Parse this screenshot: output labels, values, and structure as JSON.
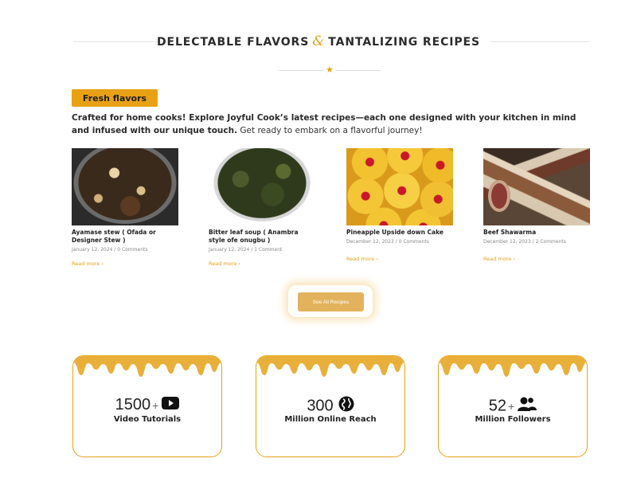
{
  "section": {
    "title_part1": "DELECTABLE FLAVORS",
    "title_amp": "&",
    "title_part2": "TANTALIZING RECIPES",
    "badge": "Fresh flavors",
    "intro_bold": "Crafted for home cooks!  Explore Joyful Cook’s latest recipes—each one designed with your kitchen in mind and infused with our unique touch.",
    "intro_regular": " Get ready to embark on a flavorful journey!"
  },
  "recipes": [
    {
      "title": "Ayamase stew ( Ofada or Designer Stew )",
      "date": "January 12, 2024",
      "comments": "0 Comments",
      "read_more": "Read more",
      "image": "ayamase-stew-photo"
    },
    {
      "title": "Bitter leaf soup ( Anambra style ofe onugbu )",
      "date": "January 12, 2024",
      "comments": "1 Comment",
      "read_more": "Read more",
      "image": "bitter-leaf-soup-photo"
    },
    {
      "title": "Pineapple Upside down Cake",
      "date": "December 12, 2023",
      "comments": "0 Comments",
      "read_more": "Read more",
      "image": "pineapple-cake-photo"
    },
    {
      "title": "Beef Shawarma",
      "date": "December 12, 2023",
      "comments": "2 Comments",
      "read_more": "Read more",
      "image": "beef-shawarma-photo"
    }
  ],
  "cta": {
    "label": "See All Recipes"
  },
  "stats": [
    {
      "number": "1500",
      "plus": "+",
      "label": "Video Tutorials",
      "icon": "youtube-icon"
    },
    {
      "number": "300",
      "plus": "",
      "label": "Million Online Reach",
      "icon": "globe-icon"
    },
    {
      "number": "52",
      "plus": "+",
      "label": "Million Followers",
      "icon": "users-icon"
    }
  ],
  "colors": {
    "accent": "#e8a115",
    "cta": "#e2b35c",
    "text": "#222222"
  },
  "meta_separator": "/",
  "read_more_arrow": "›"
}
